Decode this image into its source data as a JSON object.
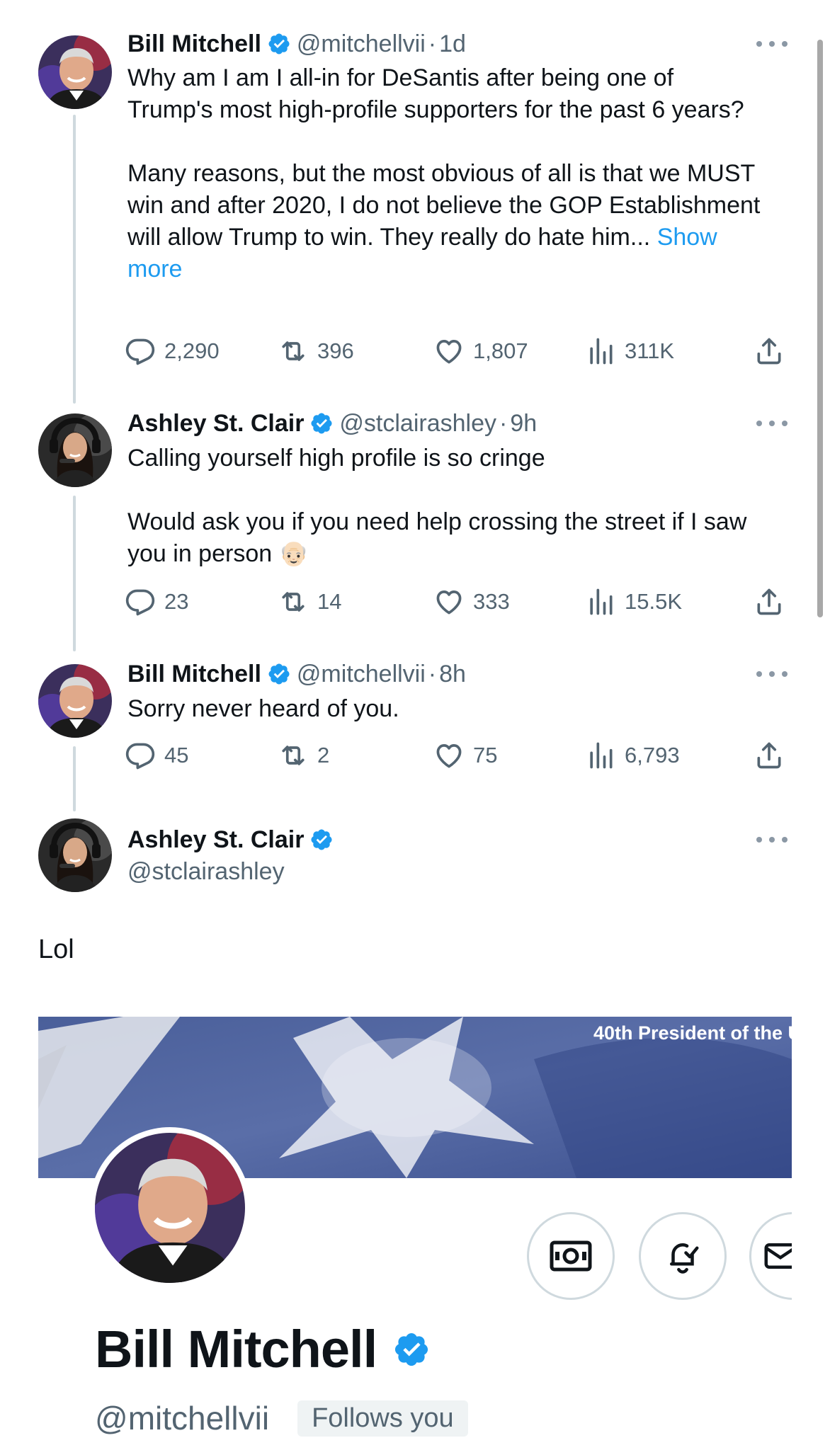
{
  "colors": {
    "verified": "#1d9bf0",
    "link": "#1d9bf0",
    "secondary_text": "#536471",
    "primary_text": "#0f1419",
    "thread_line": "#cfd9de"
  },
  "tweets": [
    {
      "name": "Bill Mitchell",
      "handle": "@mitchellvii",
      "dot": "·",
      "time": "1d",
      "paragraphs": [
        "Why am I am I all-in for DeSantis after being one of Trump's most high-profile supporters for the past 6 years?",
        "Many reasons, but the most obvious of all is that we MUST win and after 2020, I do not believe the GOP Establishment will allow Trump to win.  They really do hate him..."
      ],
      "show_more": "Show more",
      "replies": "2,290",
      "retweets": "396",
      "likes": "1,807",
      "views": "311K"
    },
    {
      "name": "Ashley St. Clair",
      "handle": "@stclairashley",
      "dot": "·",
      "time": "9h",
      "paragraphs": [
        "Calling yourself high profile is so cringe",
        "Would ask you if you need help crossing the street if I saw you in person"
      ],
      "emoji": "👴🏻",
      "replies": "23",
      "retweets": "14",
      "likes": "333",
      "views": "15.5K"
    },
    {
      "name": "Bill Mitchell",
      "handle": "@mitchellvii",
      "dot": "·",
      "time": "8h",
      "paragraphs": [
        "Sorry never heard of you."
      ],
      "replies": "45",
      "retweets": "2",
      "likes": "75",
      "views": "6,793"
    }
  ],
  "main_tweet": {
    "name": "Ashley St. Clair",
    "handle": "@stclairashley",
    "text": "Lol"
  },
  "profile_card": {
    "banner_caption": "40th President of the U",
    "name": "Bill Mitchell",
    "handle": "@mitchellvii",
    "follows_badge": "Follows you"
  },
  "icons": {
    "reply": "reply-icon",
    "retweet": "retweet-icon",
    "like": "heart-icon",
    "views": "views-icon",
    "share": "share-icon",
    "more": "more-icon",
    "verified": "verified-badge-icon",
    "money": "money-icon",
    "bell": "bell-icon",
    "message": "message-icon"
  }
}
